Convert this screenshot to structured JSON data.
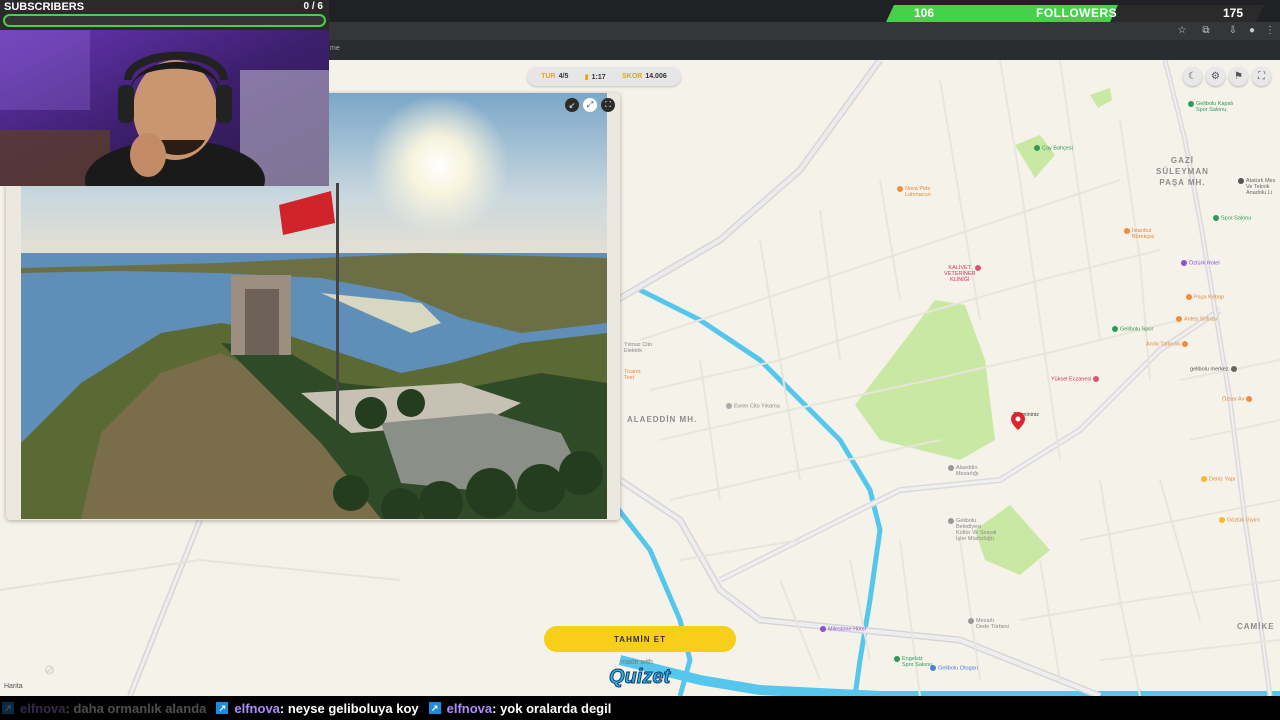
{
  "stream": {
    "subscribers": {
      "label": "SUBSCRIBERS",
      "count": "0 / 6",
      "progress": 0
    },
    "followers": {
      "count": "106",
      "label": "FOLLOWERS",
      "goal": "175",
      "progress": 0.606
    }
  },
  "browser": {
    "bookmark_fragment": "me"
  },
  "game": {
    "hud": {
      "round_key": "TUR",
      "round_value": "4/5",
      "timer_value": "1:17",
      "score_key": "SKOR",
      "score_value": "14.006"
    },
    "guess_button": "TAHMİN ET",
    "made_with": "made with",
    "logo": "Quizet",
    "guess_marker_label": "Tahmininiz"
  },
  "map": {
    "attribution": "Harita",
    "districts": {
      "gazi": "GAZİ\nSÜLEYMAN\nPAŞA MH.",
      "alaeddin": "ALAEDDİN MH.",
      "camikebir": "CAMİKE"
    },
    "pois": {
      "gelibolu_kapali": "Gelibolu Kapalı\nSpor Salonu",
      "cay_bahcesi": "Çay Bahçesi",
      "ataturk": "Atatürk Mes\nVe Teknik\nAnadolu Li",
      "nova_pide": "Nova Pide\nLahmacun",
      "spor_salonu": "Spor Salonu",
      "istanbul_borekcisi": "İstanbul\nBörekçisi",
      "ozturk_hotel": "Öztürk Hotel",
      "kalivet": "KALİVET\nVETERİNER\nKLİNİĞİ",
      "pasa_kebap": "Paşa Kebap",
      "antep_sofrasi": "Antep Sofrası",
      "gelibolu_spor": "Gelibolu Spor",
      "anda_tatlicilik": "Anda Tatlıcılık",
      "gelibolu_merkez": "gelibolu merkez",
      "yuksel_eczanesi": "Yüksel Eczanesi",
      "ozsar_av": "Özsar Av",
      "yilmaz_cito": "Yılmaz Cito\nElektrik",
      "ticaret": "Ticaret\nTest",
      "evren_cito": "Evren Cito Yıkama",
      "alaeddin_mezarligi": "Alaeddin\nMezarlığı",
      "deniz_yapi": "Deniz Yapı",
      "gozluk_giyim": "Gözlük Giyim",
      "belediye": "Gelibolu\nBelediyesi\nKültür Ve Sosyal\nİşler Müdürlüğü",
      "milestone": "Milestone Hotel",
      "mezarli": "Mezarlı\nDede Türbesi",
      "engelsiz": "Engelsiz\nSpor Salonu",
      "otogar": "Gelibolu Otogarı"
    }
  },
  "chat": [
    {
      "user": "elfnova",
      "text": ": daha ormanlık alanda",
      "faded": true
    },
    {
      "user": "elfnova",
      "text": ": neyse geliboluya koy",
      "faded": false
    },
    {
      "user": "elfnova",
      "text": ": yok oralarda degil",
      "faded": false
    }
  ],
  "colors": {
    "accent_yellow": "#f7cf1b",
    "progress_green": "#45d14a",
    "map_bg": "#f5f2ea",
    "water": "#56c7ec",
    "park": "#c9e8a3"
  }
}
